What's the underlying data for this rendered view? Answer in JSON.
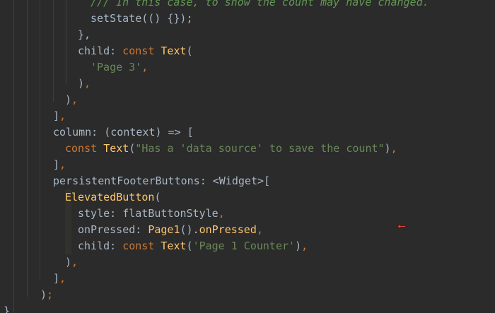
{
  "editor": {
    "lines": [
      {
        "tokens": [
          {
            "t": "/// In this case, to show the count may have changed.",
            "c": "comment"
          }
        ]
      },
      {
        "tokens": [
          {
            "t": "setState(() {});",
            "c": "plain"
          }
        ]
      },
      {
        "tokens": [
          {
            "t": "},",
            "c": "plain"
          }
        ]
      },
      {
        "tokens": [
          {
            "t": "child: ",
            "c": "plain"
          },
          {
            "t": "const ",
            "c": "keyword"
          },
          {
            "t": "Text",
            "c": "class"
          },
          {
            "t": "(",
            "c": "plain"
          }
        ]
      },
      {
        "tokens": [
          {
            "t": "'Page 3'",
            "c": "string"
          },
          {
            "t": ",",
            "c": "punct"
          }
        ]
      },
      {
        "tokens": [
          {
            "t": ")",
            "c": "plain"
          },
          {
            "t": ",",
            "c": "punct"
          }
        ]
      },
      {
        "tokens": [
          {
            "t": ")",
            "c": "plain"
          },
          {
            "t": ",",
            "c": "punct"
          }
        ]
      },
      {
        "tokens": [
          {
            "t": "]",
            "c": "plain"
          },
          {
            "t": ",",
            "c": "punct"
          }
        ]
      },
      {
        "tokens": [
          {
            "t": "column: (context) => [",
            "c": "plain"
          }
        ]
      },
      {
        "tokens": [
          {
            "t": "const ",
            "c": "keyword"
          },
          {
            "t": "Text",
            "c": "class"
          },
          {
            "t": "(",
            "c": "plain"
          },
          {
            "t": "\"Has a 'data source' to save the count\"",
            "c": "string"
          },
          {
            "t": ")",
            "c": "plain"
          },
          {
            "t": ",",
            "c": "punct"
          }
        ]
      },
      {
        "tokens": [
          {
            "t": "]",
            "c": "plain"
          },
          {
            "t": ",",
            "c": "punct"
          }
        ]
      },
      {
        "tokens": [
          {
            "t": "persistentFooterButtons: <Widget>[",
            "c": "plain"
          }
        ]
      },
      {
        "tokens": [
          {
            "t": "ElevatedButton",
            "c": "class"
          },
          {
            "t": "(",
            "c": "plain"
          }
        ]
      },
      {
        "tokens": [
          {
            "t": "style: flatButtonStyle",
            "c": "plain"
          },
          {
            "t": ",",
            "c": "punct"
          }
        ]
      },
      {
        "tokens": [
          {
            "t": "onPressed: ",
            "c": "plain"
          },
          {
            "t": "Page1",
            "c": "class"
          },
          {
            "t": "().",
            "c": "plain"
          },
          {
            "t": "onPressed",
            "c": "class"
          },
          {
            "t": ",",
            "c": "punct"
          }
        ]
      },
      {
        "tokens": [
          {
            "t": "child: ",
            "c": "plain"
          },
          {
            "t": "const ",
            "c": "keyword"
          },
          {
            "t": "Text",
            "c": "class"
          },
          {
            "t": "(",
            "c": "plain"
          },
          {
            "t": "'Page 1 Counter'",
            "c": "string"
          },
          {
            "t": ")",
            "c": "plain"
          },
          {
            "t": ",",
            "c": "punct"
          }
        ]
      },
      {
        "tokens": [
          {
            "t": ")",
            "c": "plain"
          },
          {
            "t": ",",
            "c": "punct"
          }
        ]
      },
      {
        "tokens": [
          {
            "t": "]",
            "c": "plain"
          },
          {
            "t": ",",
            "c": "punct"
          }
        ]
      },
      {
        "tokens": [
          {
            "t": ")",
            "c": "plain"
          },
          {
            "t": ";",
            "c": "punct"
          }
        ]
      },
      {
        "tokens": [
          {
            "t": "}",
            "c": "plain"
          }
        ]
      }
    ]
  },
  "colors": {
    "background": "#2b2b2b",
    "plain": "#a9b7c6",
    "keyword": "#cc7832",
    "class": "#ffc66d",
    "string": "#6a8759",
    "comment": "#629755",
    "marker": "#e0443e"
  },
  "icons": {
    "marker": "red-arrow-icon"
  }
}
